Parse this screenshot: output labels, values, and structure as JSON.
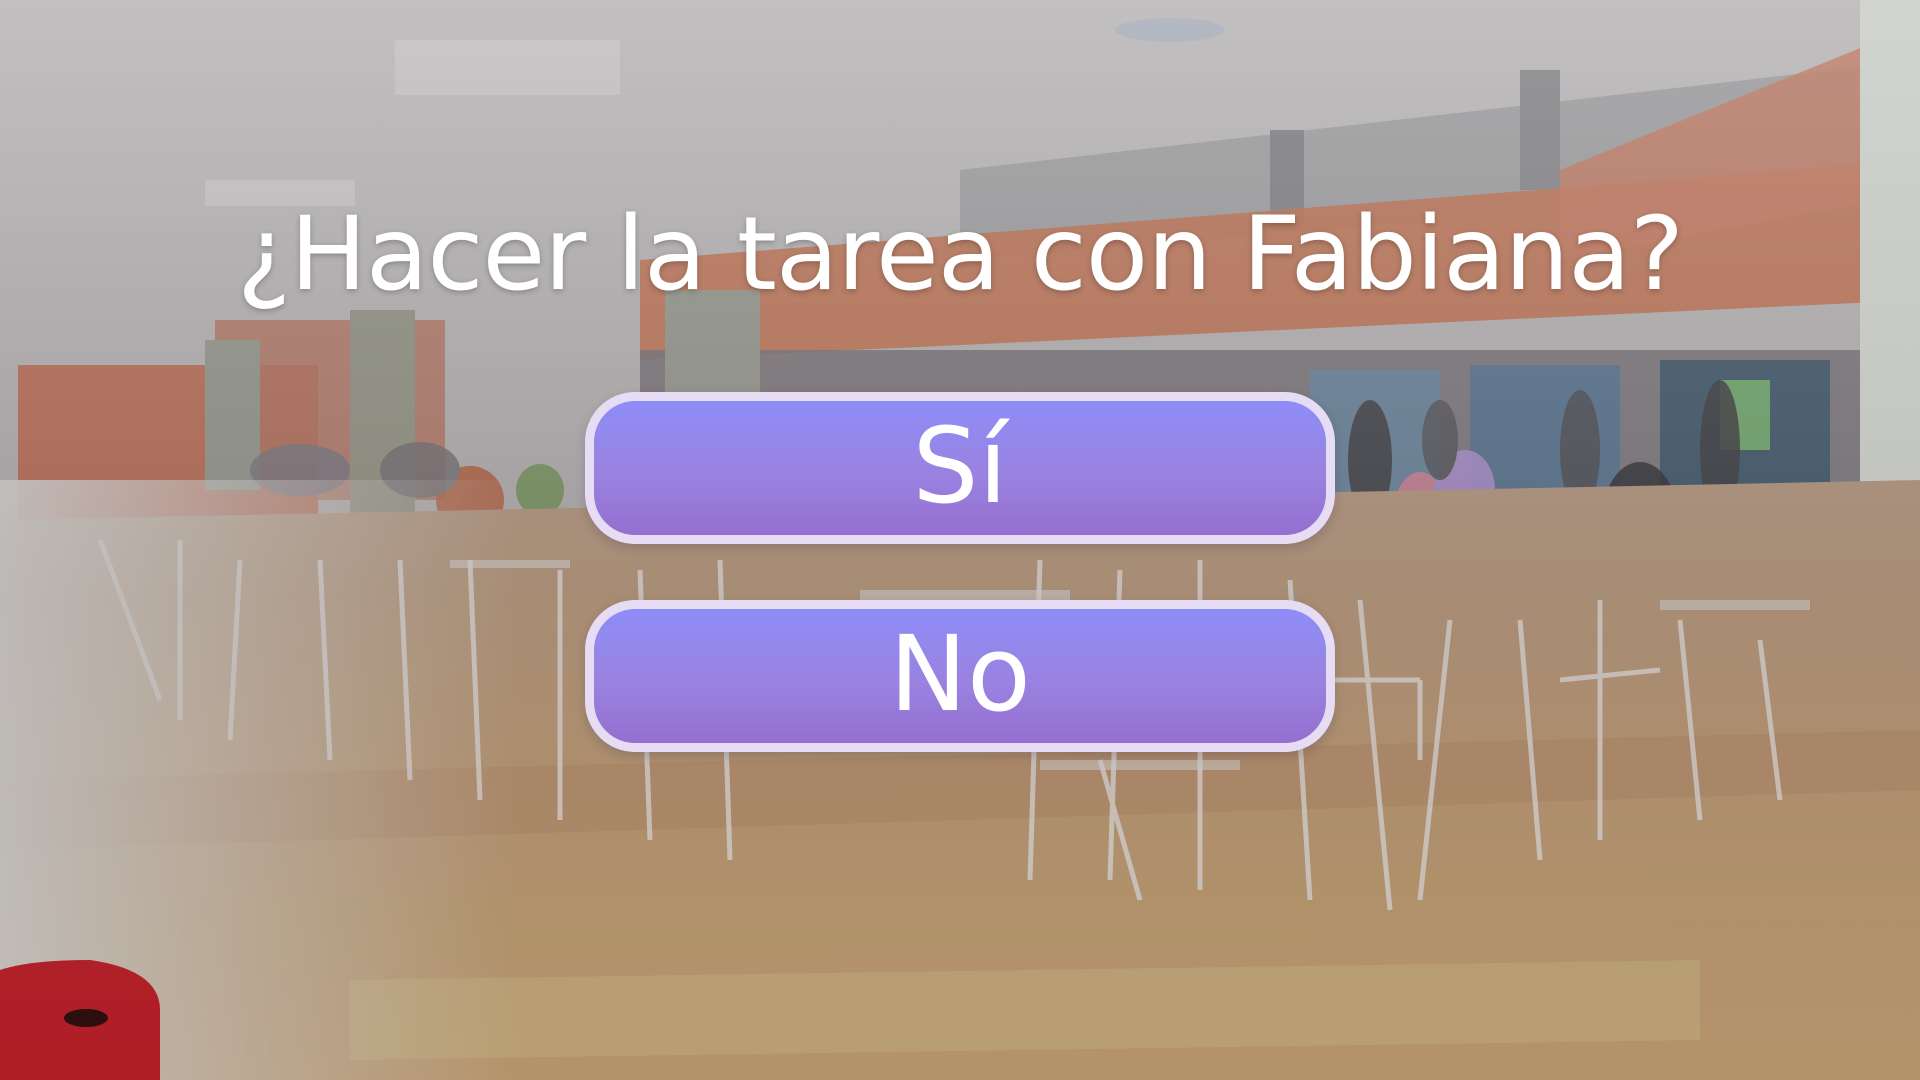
{
  "dialogue": {
    "question": "¿Hacer la tarea con Fabiana?"
  },
  "choices": [
    {
      "label": "Sí"
    },
    {
      "label": "No"
    }
  ],
  "colors": {
    "button_top": "#8e8df8",
    "button_bottom": "#946fd0",
    "button_border": "#e6dcf3",
    "text": "#ffffff"
  }
}
